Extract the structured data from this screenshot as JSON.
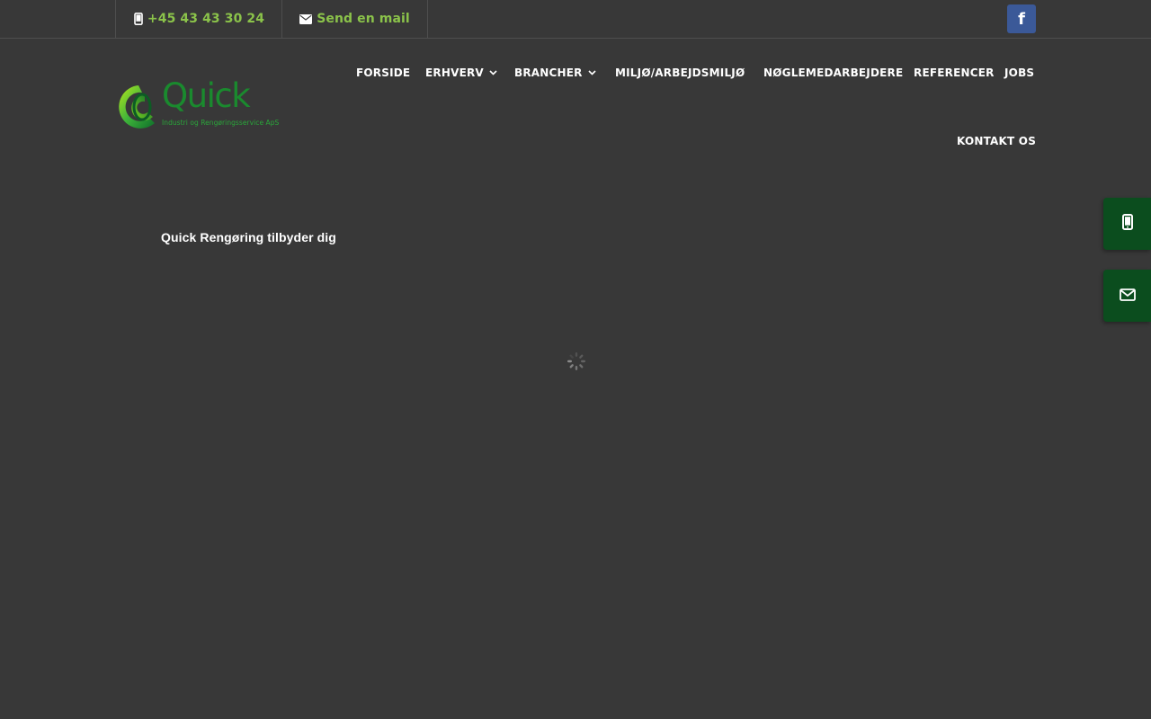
{
  "topbar": {
    "phone": {
      "icon": "mobile-phone-icon",
      "label": "+45 43 43 30 24"
    },
    "email": {
      "icon": "envelope-icon",
      "label": "Send en mail"
    },
    "social": {
      "icon": "facebook-icon",
      "label": "f",
      "color": "#3b5998"
    }
  },
  "logo": {
    "wordmark": "Quick",
    "tagline": "Industri og Rengøringsservice ApS",
    "colors": {
      "green": "#1a8a2e",
      "light_green": "#8bc34a"
    }
  },
  "nav": {
    "items": [
      {
        "label": "FORSIDE",
        "has_dropdown": false
      },
      {
        "label": "ERHVERV",
        "has_dropdown": true
      },
      {
        "label": "BRANCHER",
        "has_dropdown": true
      },
      {
        "label": "MILJØ/ARBEJDSMILJØ",
        "has_dropdown": false
      },
      {
        "label": "NØGLEMEDARBEJDERE",
        "has_dropdown": false
      },
      {
        "label": "REFERENCER",
        "has_dropdown": false
      },
      {
        "label": "JOBS",
        "has_dropdown": false
      },
      {
        "label": "KONTAKT OS",
        "has_dropdown": false
      }
    ]
  },
  "main": {
    "intro": "Quick Rengøring tilbyder dig",
    "loading_icon": "spinner-icon"
  },
  "side_buttons": [
    {
      "icon": "mobile-phone-icon",
      "color": "#0b4d1e"
    },
    {
      "icon": "envelope-icon",
      "color": "#0b4d1e"
    }
  ],
  "theme": {
    "background": "#383838",
    "accent": "#8bc34a"
  }
}
